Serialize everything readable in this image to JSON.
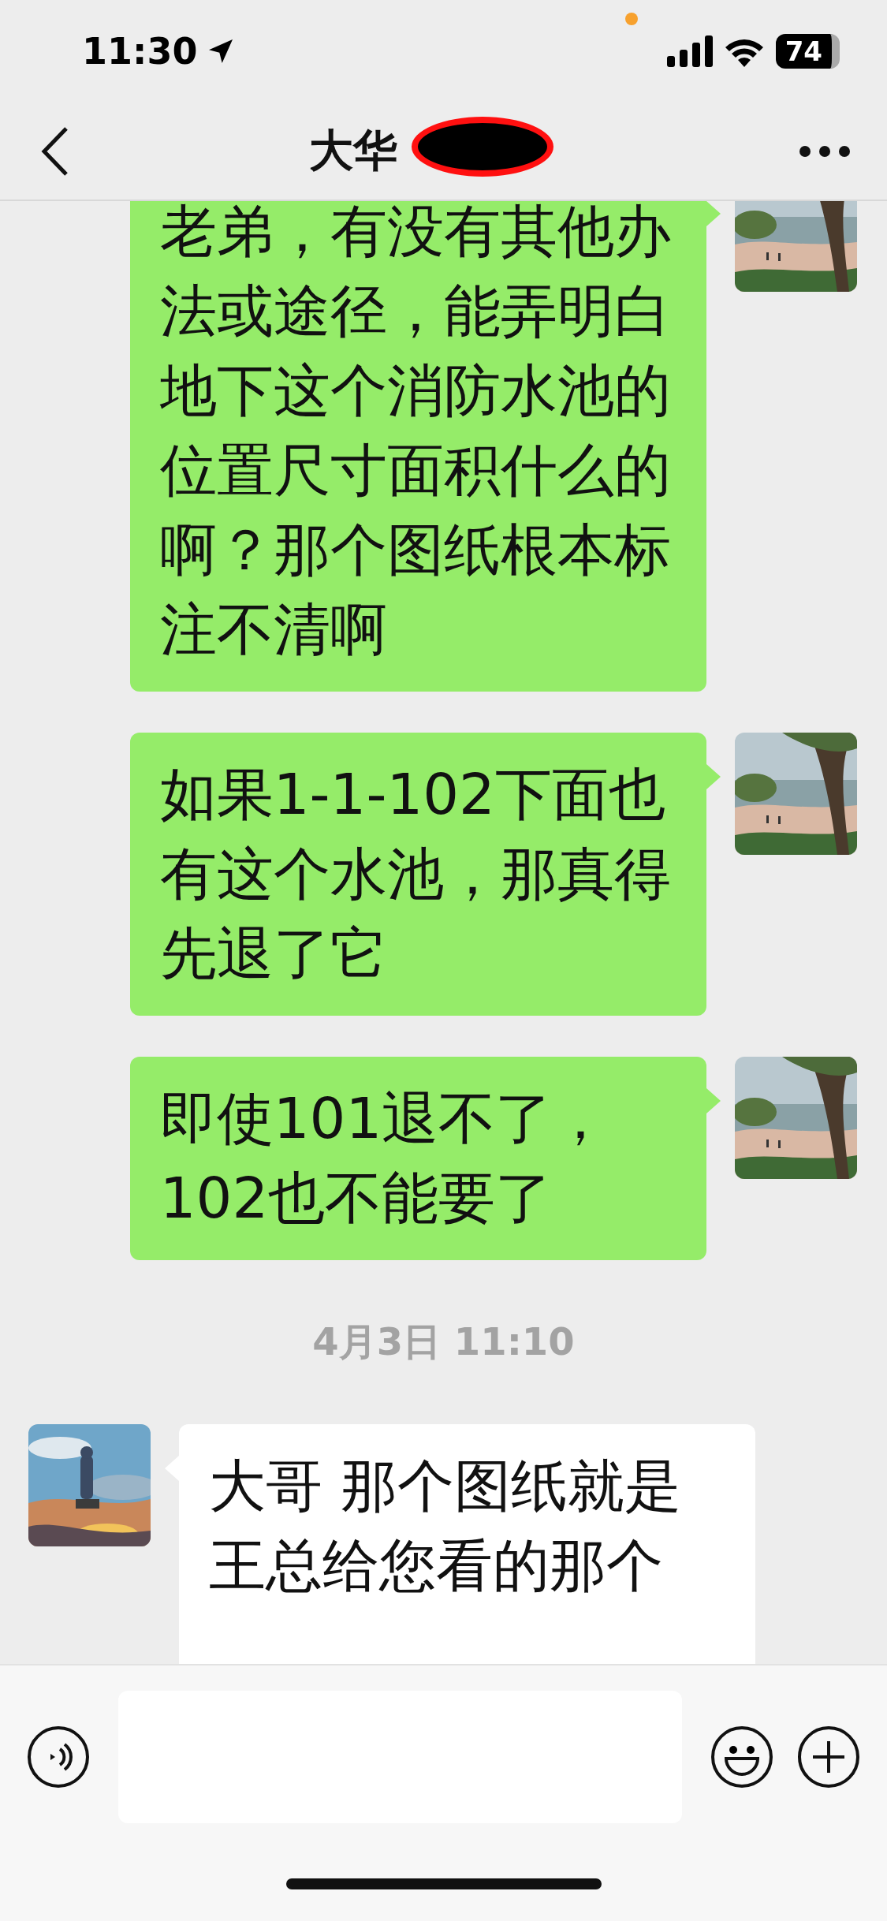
{
  "status_bar": {
    "time": "11:30",
    "battery": "74"
  },
  "header": {
    "title": "大华"
  },
  "messages": [
    {
      "kind": "outgoing",
      "text": "老弟，有没有其他办法或途径，能弄明白地下这个消防水池的位置尺寸面积什么的啊？那个图纸根本标注不清啊"
    },
    {
      "kind": "outgoing",
      "text": "如果1-1-102下面也有这个水池，那真得先退了它"
    },
    {
      "kind": "outgoing",
      "text": "即使101退不了，102也不能要了"
    },
    {
      "kind": "time",
      "text": "4月3日 11:10"
    },
    {
      "kind": "incoming",
      "text": "大哥 那个图纸就是王总给您看的那个"
    }
  ]
}
